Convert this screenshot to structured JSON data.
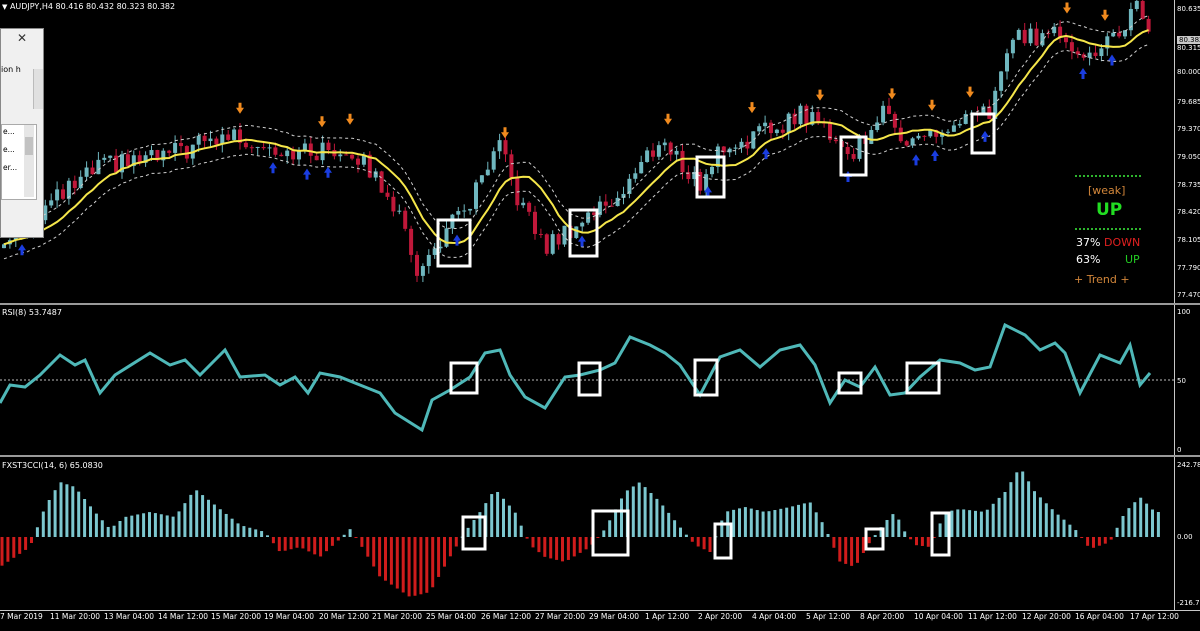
{
  "chart_header": {
    "arrow_glyph": "▼",
    "symbol_info": "AUDJPY,H4  80.416 80.432 80.323 80.382"
  },
  "price_axis": {
    "labels": [
      "80.635",
      "80.382",
      "80.315",
      "80.000",
      "79.685",
      "79.370",
      "79.050",
      "78.735",
      "78.420",
      "78.105",
      "77.790",
      "77.470"
    ],
    "current_price": "80.382",
    "current_price_bg": "#c8c8c8"
  },
  "rsi_pane": {
    "label": "RSI(8) 53.7487",
    "axis_labels": [
      "100",
      "50",
      "0"
    ],
    "line_color": "#4fb8b8"
  },
  "cci_pane": {
    "label": "FXST3CCI(14, 6) 65.0830",
    "axis_labels": [
      "242.787",
      "0.00",
      "-216.770"
    ],
    "positive_color": "#7cc7cf",
    "negative_color": "#d01c1c"
  },
  "time_axis": {
    "labels": [
      "7 Mar 2019",
      "11 Mar 20:00",
      "13 Mar 04:00",
      "14 Mar 12:00",
      "15 Mar 20:00",
      "19 Mar 04:00",
      "20 Mar 12:00",
      "21 Mar 20:00",
      "25 Mar 04:00",
      "26 Mar 12:00",
      "27 Mar 20:00",
      "29 Mar 04:00",
      "1 Apr 12:00",
      "2 Apr 20:00",
      "4 Apr 04:00",
      "5 Apr 12:00",
      "8 Apr 20:00",
      "10 Apr 04:00",
      "11 Apr 12:00",
      "12 Apr 20:00",
      "16 Apr 04:00",
      "17 Apr 12:00"
    ]
  },
  "dialog": {
    "close_glyph": "✕",
    "text_fragment": "ion h",
    "list_items": [
      "e...",
      "e...",
      "er...",
      ""
    ]
  },
  "trend_panel": {
    "strength": "[weak]",
    "direction": "UP",
    "down_pct": "37%",
    "down_label": "DOWN",
    "up_pct": "63%",
    "up_label": "UP",
    "trend_label": "+   Trend   +",
    "colors": {
      "strength": "#d2863a",
      "direction": "#22dd22",
      "down": "#e02020",
      "up": "#22cc22",
      "trend": "#d2863a",
      "pct": "#ffffff"
    }
  },
  "colors": {
    "bull_candle": "#6fb7bf",
    "bear_candle": "#c0183a",
    "ma_line": "#f5e64a",
    "envelope": "#cfcfcf",
    "buy_arrow": "#1a3de0",
    "sell_arrow": "#f08a1e",
    "highlight_box": "#ffffff"
  }
}
